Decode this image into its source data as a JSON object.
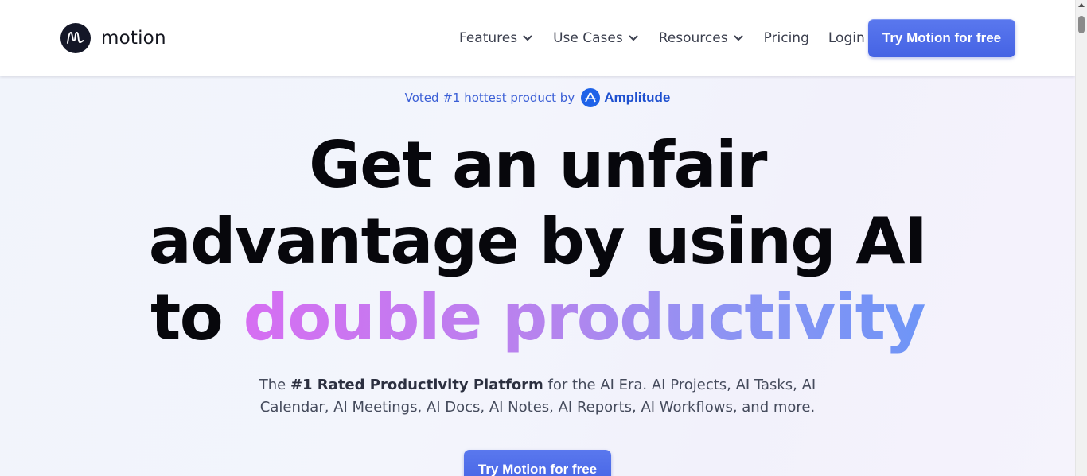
{
  "header": {
    "logo_text": "motion",
    "nav": [
      {
        "label": "Features",
        "has_dropdown": true
      },
      {
        "label": "Use Cases",
        "has_dropdown": true
      },
      {
        "label": "Resources",
        "has_dropdown": true
      },
      {
        "label": "Pricing",
        "has_dropdown": false
      },
      {
        "label": "Login",
        "has_dropdown": false
      }
    ],
    "cta_label": "Try Motion for free"
  },
  "badge": {
    "text": "Voted #1 hottest product by",
    "brand": "Amplitude"
  },
  "hero": {
    "line1": "Get an unfair",
    "line2": "advantage by using AI",
    "line3_prefix": "to ",
    "line3_highlight": "double productivity",
    "sub_prefix": "The ",
    "sub_bold": "#1 Rated Productivity Platform",
    "sub_line1_rest": " for the AI Era. AI Projects, AI Tasks, AI",
    "sub_line2": "Calendar, AI Meetings, AI Docs, AI Notes, AI Reports, AI Workflows, and more.",
    "cta_label": "Try Motion for free"
  },
  "colors": {
    "primary_button": "#4f6de9",
    "gradient_start": "#d66ef2",
    "gradient_end": "#6e95f7",
    "badge_text": "#3b5fd6",
    "amplitude_blue": "#1e62e8"
  },
  "icons": {
    "logo": "motion-logo-icon",
    "dropdown": "chevron-down-icon",
    "amplitude": "amplitude-logo-icon"
  }
}
